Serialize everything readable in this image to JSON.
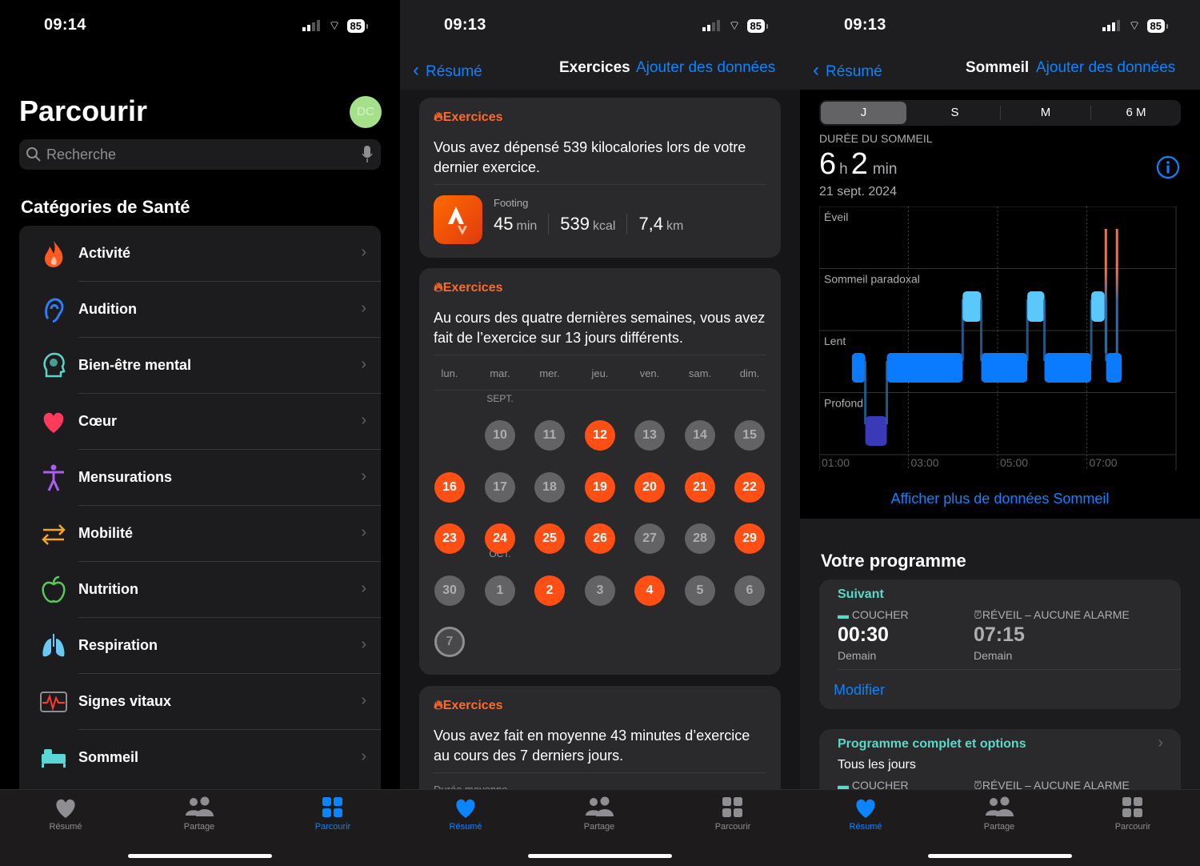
{
  "panel1": {
    "status": {
      "time": "09:14",
      "battery": "85"
    },
    "title": "Parcourir",
    "avatar": "DC",
    "avatar_color": "#a6e08a",
    "search_placeholder": "Recherche",
    "section": "Catégories de Santé",
    "categories": [
      {
        "label": "Activité",
        "icon": "flame-icon",
        "color": "#ff5a1f"
      },
      {
        "label": "Audition",
        "icon": "ear-icon",
        "color": "#2f7cf6"
      },
      {
        "label": "Bien-être mental",
        "icon": "head-icon",
        "color": "#5ad6c8"
      },
      {
        "label": "Cœur",
        "icon": "heart-icon",
        "color": "#ff3b5c"
      },
      {
        "label": "Mensurations",
        "icon": "figure-icon",
        "color": "#b05cf0"
      },
      {
        "label": "Mobilité",
        "icon": "arrows-icon",
        "color": "#f5a623"
      },
      {
        "label": "Nutrition",
        "icon": "apple-icon",
        "color": "#5ac85a"
      },
      {
        "label": "Respiration",
        "icon": "lungs-icon",
        "color": "#6ac8f5"
      },
      {
        "label": "Signes vitaux",
        "icon": "waveform-icon",
        "color": "#ff3b30"
      },
      {
        "label": "Sommeil",
        "icon": "bed-icon",
        "color": "#5ad6d6"
      }
    ],
    "tabs": [
      {
        "label": "Résumé",
        "active": false
      },
      {
        "label": "Partage",
        "active": false
      },
      {
        "label": "Parcourir",
        "active": true
      }
    ]
  },
  "panel2": {
    "status": {
      "time": "09:13",
      "battery": "85"
    },
    "nav": {
      "back": "Résumé",
      "title": "Exercices",
      "add": "Ajouter des données"
    },
    "card1": {
      "head": "Exercices",
      "text": "Vous avez dépensé 539 kilocalories lors de votre dernier exercice.",
      "workout": "Footing",
      "duration": "45",
      "duration_unit": "min",
      "energy": "539",
      "energy_unit": "kcal",
      "distance": "7,4",
      "distance_unit": "km"
    },
    "card2": {
      "head": "Exercices",
      "text": "Au cours des quatre dernières semaines, vous avez fait de l’exercice sur 13 jours différents.",
      "weekdays": [
        "lun.",
        "mar.",
        "mer.",
        "jeu.",
        "ven.",
        "sam.",
        "dim."
      ],
      "months": [
        {
          "label": "SEPT.",
          "week": 0
        },
        {
          "label": "OCT.",
          "week": 3
        }
      ],
      "weeks": [
        [
          null,
          {
            "d": "10",
            "s": "g"
          },
          {
            "d": "11",
            "s": "g"
          },
          {
            "d": "12",
            "s": "o"
          },
          {
            "d": "13",
            "s": "g"
          },
          {
            "d": "14",
            "s": "g"
          },
          {
            "d": "15",
            "s": "g"
          }
        ],
        [
          {
            "d": "16",
            "s": "o"
          },
          {
            "d": "17",
            "s": "g"
          },
          {
            "d": "18",
            "s": "g"
          },
          {
            "d": "19",
            "s": "o"
          },
          {
            "d": "20",
            "s": "o"
          },
          {
            "d": "21",
            "s": "o"
          },
          {
            "d": "22",
            "s": "o"
          }
        ],
        [
          {
            "d": "23",
            "s": "o"
          },
          {
            "d": "24",
            "s": "o"
          },
          {
            "d": "25",
            "s": "o"
          },
          {
            "d": "26",
            "s": "o"
          },
          {
            "d": "27",
            "s": "g"
          },
          {
            "d": "28",
            "s": "g"
          },
          {
            "d": "29",
            "s": "o"
          }
        ],
        [
          {
            "d": "30",
            "s": "g"
          },
          {
            "d": "1",
            "s": "g"
          },
          {
            "d": "2",
            "s": "o"
          },
          {
            "d": "3",
            "s": "g"
          },
          {
            "d": "4",
            "s": "o"
          },
          {
            "d": "5",
            "s": "g"
          },
          {
            "d": "6",
            "s": "g"
          }
        ],
        [
          {
            "d": "7",
            "s": "t"
          }
        ]
      ]
    },
    "card3": {
      "head": "Exercices",
      "text": "Vous avez fait en moyenne 43 minutes d’exercice au cours des 7 derniers jours.",
      "sub": "Durée moyenne"
    },
    "tabs": [
      {
        "label": "Résumé",
        "active": true
      },
      {
        "label": "Partage",
        "active": false
      },
      {
        "label": "Parcourir",
        "active": false
      }
    ],
    "accent": "#ff4f14"
  },
  "panel3": {
    "status": {
      "time": "09:13",
      "battery": "85"
    },
    "nav": {
      "back": "Résumé",
      "title": "Sommeil",
      "add": "Ajouter des données"
    },
    "ranges": [
      "J",
      "S",
      "M",
      "6 M"
    ],
    "selected_range": "J",
    "label": "DURÉE DU SOMMEIL",
    "hours": "6",
    "h_unit": "h",
    "minutes": "2",
    "min_unit": "min",
    "date": "21 sept. 2024",
    "more_link": "Afficher plus de données Sommeil",
    "program_title": "Votre programme",
    "next": {
      "head": "Suivant",
      "bed_label": "COUCHER",
      "bed_time": "00:30",
      "bed_day": "Demain",
      "wake_label": "RÉVEIL – AUCUNE ALARME",
      "wake_time": "07:15",
      "wake_day": "Demain",
      "edit": "Modifier"
    },
    "full": {
      "head": "Programme complet et options",
      "days": "Tous les jours",
      "bed_label": "COUCHER",
      "wake_label": "RÉVEIL – AUCUNE ALARME"
    },
    "tabs": [
      {
        "label": "Résumé",
        "active": true
      },
      {
        "label": "Partage",
        "active": false
      },
      {
        "label": "Parcourir",
        "active": false
      }
    ]
  },
  "chart_data": {
    "type": "sleep-stages",
    "stages": [
      "Éveil",
      "Sommeil paradoxal",
      "Lent",
      "Profond"
    ],
    "x_ticks": [
      "01:00",
      "03:00",
      "05:00",
      "07:00"
    ],
    "xlim": [
      "01:00",
      "09:00"
    ],
    "colors": {
      "Éveil": "#ff6b4a",
      "Sommeil paradoxal": "#5ac8fa",
      "Lent": "#0a7aff",
      "Profond": "#3a3ab8"
    },
    "segments": [
      {
        "stage": "Lent",
        "start": "01:44",
        "end": "02:02"
      },
      {
        "stage": "Profond",
        "start": "02:02",
        "end": "02:31"
      },
      {
        "stage": "Lent",
        "start": "02:31",
        "end": "04:13"
      },
      {
        "stage": "Sommeil paradoxal",
        "start": "04:13",
        "end": "04:38"
      },
      {
        "stage": "Lent",
        "start": "04:38",
        "end": "05:40"
      },
      {
        "stage": "Sommeil paradoxal",
        "start": "05:40",
        "end": "06:03"
      },
      {
        "stage": "Lent",
        "start": "06:03",
        "end": "07:06"
      },
      {
        "stage": "Sommeil paradoxal",
        "start": "07:06",
        "end": "07:24"
      },
      {
        "stage": "Éveil",
        "start": "07:24",
        "end": "07:26"
      },
      {
        "stage": "Lent",
        "start": "07:26",
        "end": "07:47"
      },
      {
        "stage": "Éveil",
        "start": "07:39",
        "end": "07:41"
      }
    ]
  }
}
